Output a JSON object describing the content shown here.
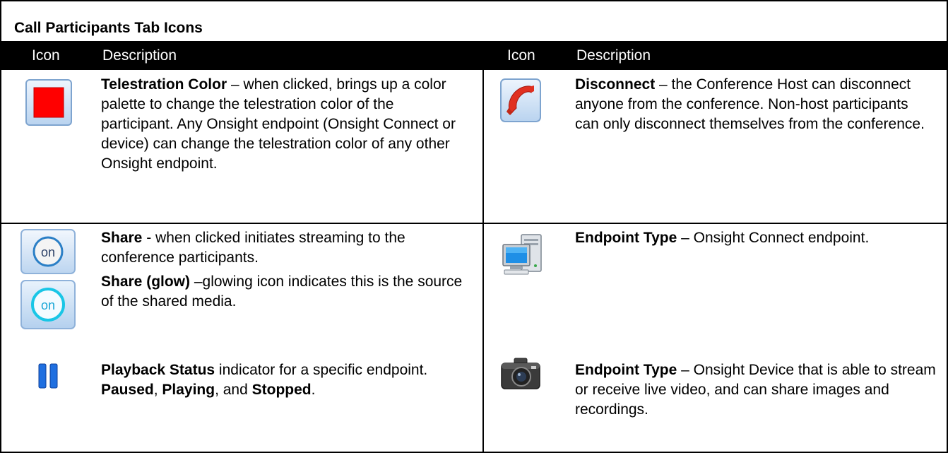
{
  "title": "Call Participants Tab Icons",
  "headers": {
    "icon": "Icon",
    "description": "Description"
  },
  "colors": {
    "header_bg": "#000000",
    "telestration_red": "#ff0000",
    "disconnect_red": "#e03020",
    "share_blue": "#2b7fc6",
    "pause_blue": "#1f6fe0"
  },
  "rows": [
    {
      "left": {
        "icon": "telestration-color-icon",
        "name": "Telestration Color",
        "text": " – when clicked, brings up a color palette to change the telestration color of the participant. Any Onsight endpoint (Onsight Connect or device) can change the telestration color of any other Onsight endpoint."
      },
      "right": {
        "icon": "disconnect-phone-icon",
        "name": "Disconnect",
        "text": " – the Conference Host can disconnect anyone from the conference. Non-host participants can only disconnect themselves from the conference."
      }
    },
    {
      "left": [
        {
          "icon": "share-on-icon",
          "name": "Share",
          "text": "  - when clicked initiates streaming to the conference participants."
        },
        {
          "icon": "share-glow-icon",
          "name": "Share (glow)",
          "text": " –glowing icon indicates this is the source of the shared media."
        },
        {
          "icon": "pause-icon",
          "name": "Playback Status",
          "text_before": " indicator for a specific endpoint. ",
          "paused": "Paused",
          "sep1": ", ",
          "playing": "Playing",
          "sep2": ", and ",
          "stopped": "Stopped",
          "end": "."
        }
      ],
      "right": [
        {
          "icon": "computer-icon",
          "name": "Endpoint Type",
          "text": " – Onsight Connect endpoint."
        },
        {
          "icon": "camera-icon",
          "name": "Endpoint Type",
          "text": " – Onsight Device that is able to stream or receive live video, and can share images and recordings."
        }
      ]
    }
  ],
  "icon_text": {
    "share_on": "on",
    "share_glow": "on"
  }
}
